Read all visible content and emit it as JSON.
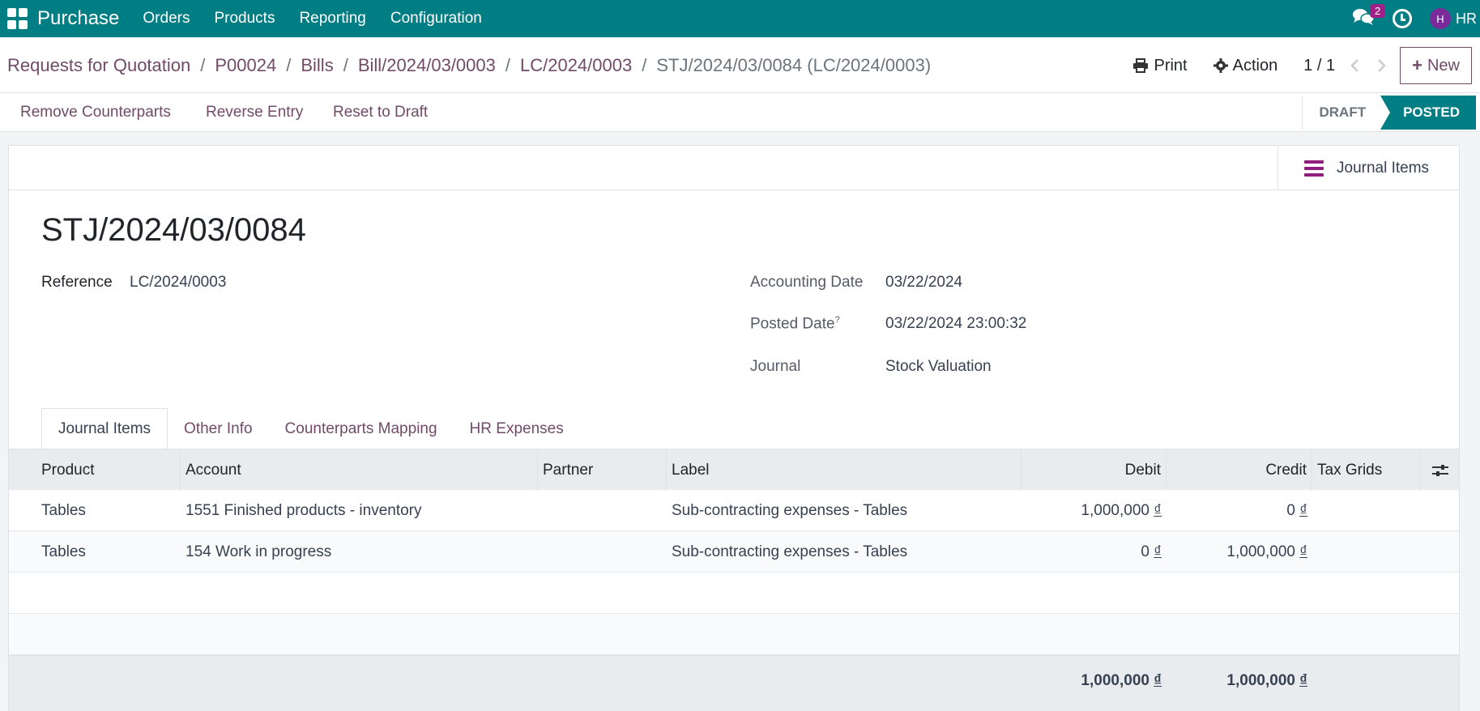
{
  "navbar": {
    "app_name": "Purchase",
    "menu": [
      "Orders",
      "Products",
      "Reporting",
      "Configuration"
    ],
    "chat_badge": "2",
    "avatar_initial": "H",
    "user": "HR"
  },
  "breadcrumb": {
    "items": [
      "Requests for Quotation",
      "P00024",
      "Bills",
      "Bill/2024/03/0003",
      "LC/2024/0003"
    ],
    "separator": "/",
    "current": "STJ/2024/03/0084 (LC/2024/0003)"
  },
  "control": {
    "print": "Print",
    "action": "Action",
    "pager": "1 / 1",
    "new": "New"
  },
  "actions": {
    "remove_counterparts": "Remove Counterparts",
    "reverse_entry": "Reverse Entry",
    "reset_to_draft": "Reset to Draft"
  },
  "status": {
    "draft": "DRAFT",
    "posted": "POSTED"
  },
  "smart_button": "Journal Items",
  "record": {
    "title": "STJ/2024/03/0084",
    "reference_label": "Reference",
    "reference": "LC/2024/0003",
    "accounting_date_label": "Accounting Date",
    "accounting_date": "03/22/2024",
    "posted_date_label": "Posted Date",
    "posted_date_help": "?",
    "posted_date": "03/22/2024 23:00:32",
    "journal_label": "Journal",
    "journal": "Stock Valuation"
  },
  "tabs": [
    "Journal Items",
    "Other Info",
    "Counterparts Mapping",
    "HR Expenses"
  ],
  "table": {
    "columns": {
      "product": "Product",
      "account": "Account",
      "partner": "Partner",
      "label": "Label",
      "debit": "Debit",
      "credit": "Credit",
      "tax_grids": "Tax Grids"
    },
    "currency": "₫",
    "rows": [
      {
        "product": "Tables",
        "account": "1551 Finished products - inventory",
        "partner": "",
        "label": "Sub-contracting expenses - Tables",
        "debit": "1,000,000",
        "credit": "0",
        "tax_grids": ""
      },
      {
        "product": "Tables",
        "account": "154 Work in progress",
        "partner": "",
        "label": "Sub-contracting expenses - Tables",
        "debit": "0",
        "credit": "1,000,000",
        "tax_grids": ""
      }
    ],
    "totals": {
      "debit": "1,000,000",
      "credit": "1,000,000"
    }
  },
  "colors": {
    "navbar": "#017e84",
    "brand": "#714b67",
    "badge": "#a01f8a"
  }
}
